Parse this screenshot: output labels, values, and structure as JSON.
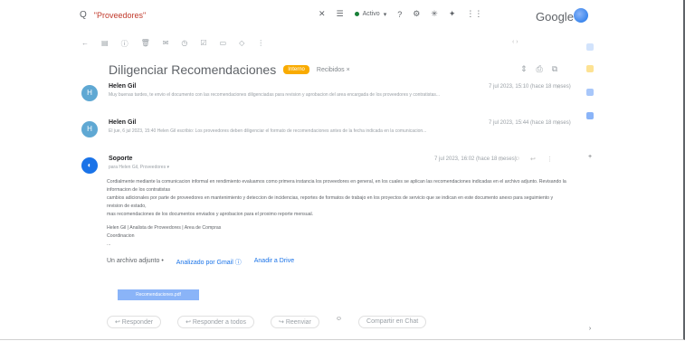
{
  "search": {
    "query": "\"Proveedores\"",
    "icon": "search-icon",
    "label": "Q"
  },
  "topbar": {
    "status": "Activo",
    "google": "Google"
  },
  "subject": {
    "title": "Diligenciar Recomendaciones",
    "label_chip": "Interno",
    "inbox_label": "Recibidos ×"
  },
  "messages": [
    {
      "avatar": "H",
      "sender": "Helen Gil",
      "snippet": "Muy buenas tardes, te envio el documento con las recomendaciones diligenciadas para revision y aprobacion del area encargada de los proveedores y contratistas...",
      "time": "7 jul 2023, 15:10 (hace 18 meses)"
    },
    {
      "avatar": "H",
      "sender": "Helen Gil",
      "snippet": "El jue, 6 jul 2023, 15:40 Helen Gil escribio: Los proveedores deben diligenciar el formato de recomendaciones antes de la fecha indicada en la comunicacion...",
      "time": "7 jul 2023, 15:44 (hace 18 meses)"
    },
    {
      "avatar": "◐",
      "sender": "Soporte",
      "snippet": "para Helen Gil, Proveedores ▾",
      "time": "7 jul 2023, 16:02 (hace 18 meses)"
    }
  ],
  "body": {
    "p1": "Cordialmente mediante la comunicacion informal en rendimiento evaluamos como primera instancia los proveedores en general, en los cuales se aplican las recomendaciones indicadas en el archivo adjunto. Revisando la informacion de los contratistas",
    "p2": "cambios adicionales por parte de proveedores en mantenimiento y deteccion de incidencias, reportes de formatos de trabajo en los proyectos de servicio que se indican en este documento anexo para seguimiento y revision de estado,",
    "p3": "mas recomendaciones de los documentos enviados y aprobacion para el proximo reporte mensual.",
    "sig1": "Helen Gil | Analista de Proveedores | Area de Compras",
    "sig2": "Coordinacion",
    "sig3": "..."
  },
  "attachments": {
    "title": "Un archivo adjunto •",
    "scan": "Analizado por Gmail ⓘ",
    "drive": "Anadir a Drive",
    "file": "Recomendaciones.pdf"
  },
  "actions": {
    "reply": "↩ Responder",
    "reply_all": "↩ Responder a todos",
    "forward": "↪ Reenviar",
    "emoji": "☺",
    "meet": "Compartir en Chat"
  },
  "colors": {
    "accent": "#1a73e8",
    "chip": "#f9ab00",
    "avatar": "#5fa8d3"
  }
}
